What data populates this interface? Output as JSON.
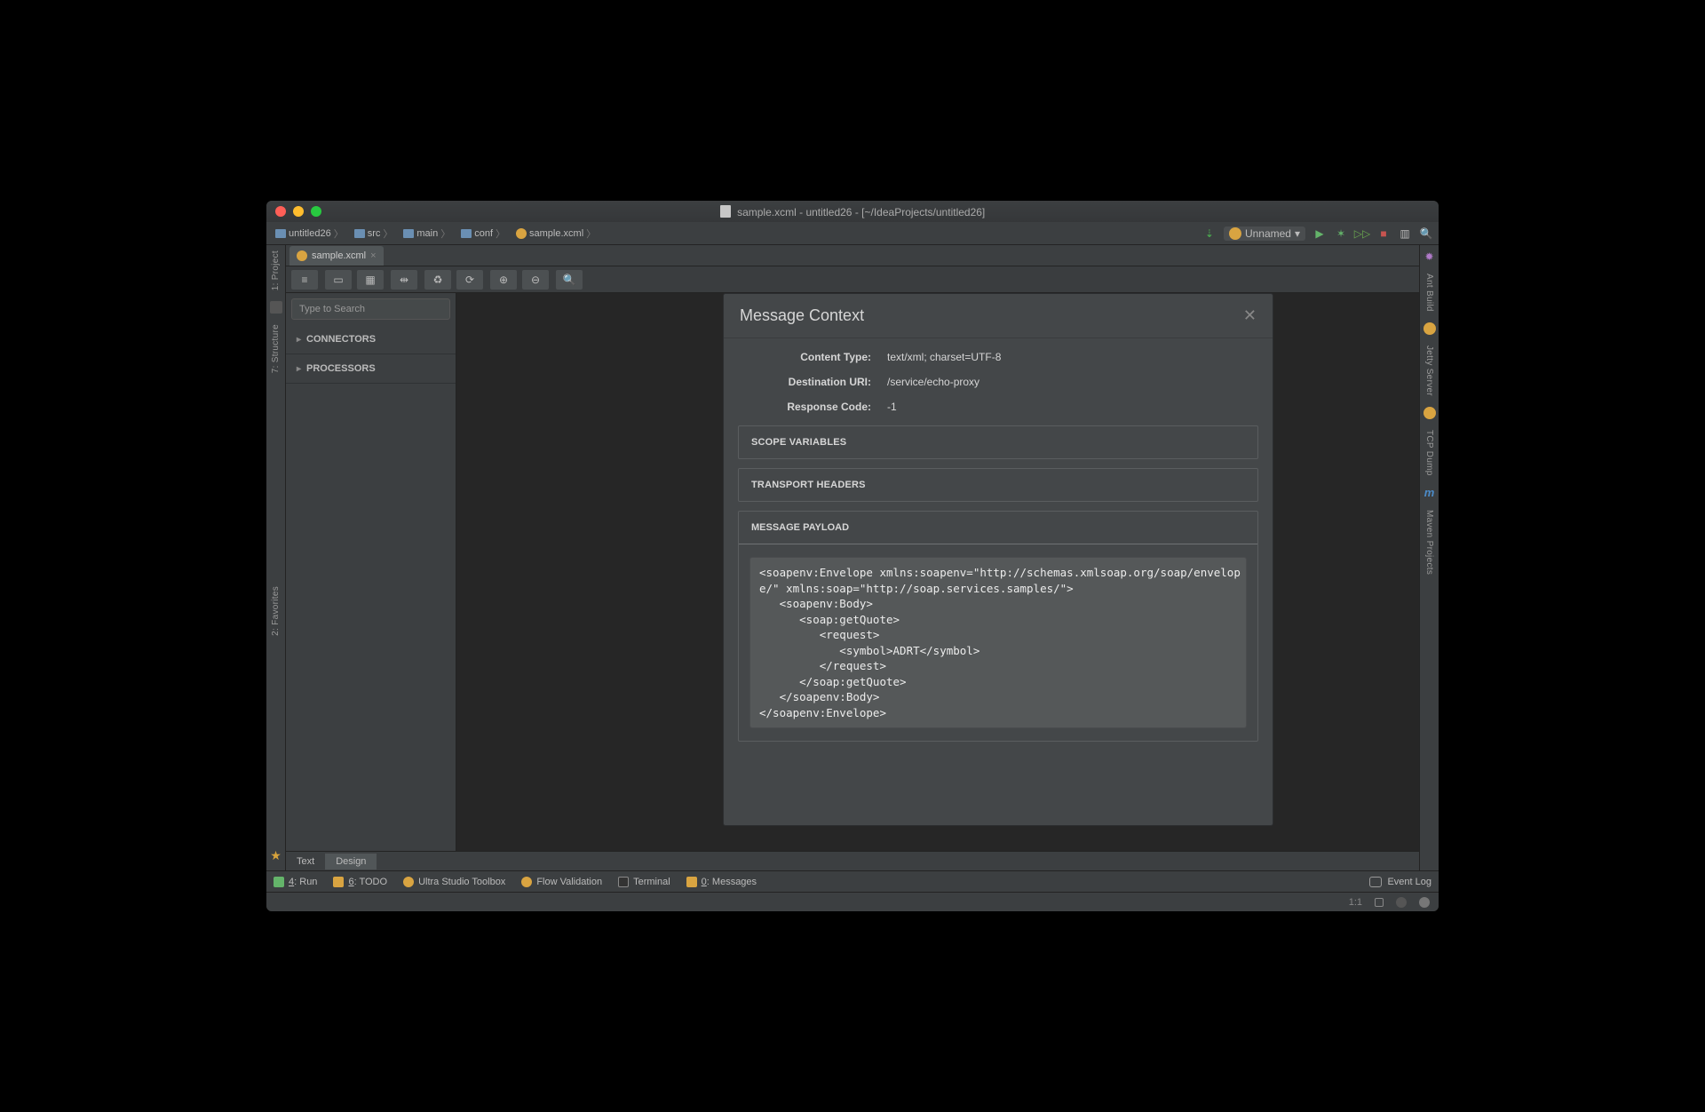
{
  "window": {
    "title_file": "sample.xcml",
    "title_project": "untitled26",
    "title_path": "[~/IdeaProjects/untitled26]"
  },
  "breadcrumb": [
    {
      "type": "folder",
      "label": "untitled26"
    },
    {
      "type": "folder",
      "label": "src"
    },
    {
      "type": "folder",
      "label": "main"
    },
    {
      "type": "folder",
      "label": "conf"
    },
    {
      "type": "xcml",
      "label": "sample.xcml"
    }
  ],
  "run_config": {
    "label": "Unnamed"
  },
  "tab": {
    "label": "sample.xcml"
  },
  "left_stripe": [
    {
      "label": "1: Project"
    },
    {
      "label": "7: Structure"
    },
    {
      "label": "2: Favorites"
    }
  ],
  "right_stripe": [
    {
      "label": "Ant Build"
    },
    {
      "label": "Jetty Server"
    },
    {
      "label": "TCP Dump"
    },
    {
      "label": "Maven Projects"
    }
  ],
  "search": {
    "placeholder": "Type to Search"
  },
  "palette": {
    "connectors": "CONNECTORS",
    "processors": "PROCESSORS"
  },
  "dialog": {
    "title": "Message Context",
    "fields": {
      "content_type": {
        "k": "Content Type:",
        "v": "text/xml; charset=UTF-8"
      },
      "destination_uri": {
        "k": "Destination URI:",
        "v": "/service/echo-proxy"
      },
      "response_code": {
        "k": "Response Code:",
        "v": "-1"
      }
    },
    "sections": {
      "scope": "SCOPE VARIABLES",
      "headers": "TRANSPORT HEADERS",
      "payload": "MESSAGE PAYLOAD"
    },
    "payload_code": "<soapenv:Envelope xmlns:soapenv=\"http://schemas.xmlsoap.org/soap/envelop\ne/\" xmlns:soap=\"http://soap.services.samples/\">\n   <soapenv:Body>\n      <soap:getQuote>\n         <request>\n            <symbol>ADRT</symbol>\n         </request>\n      </soap:getQuote>\n   </soapenv:Body>\n</soapenv:Envelope>"
  },
  "bottom_tabs": {
    "text": "Text",
    "design": "Design"
  },
  "status": {
    "run": "4: Run",
    "todo": "6: TODO",
    "toolbox": "Ultra Studio Toolbox",
    "validation": "Flow Validation",
    "terminal": "Terminal",
    "messages": "0: Messages",
    "eventlog": "Event Log"
  },
  "footer": {
    "pos": "1:1"
  }
}
